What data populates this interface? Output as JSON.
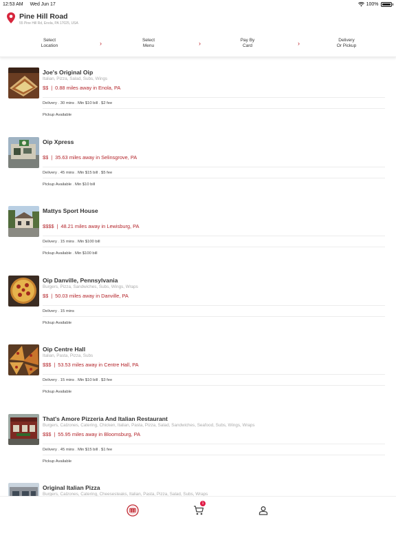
{
  "status": {
    "time": "12:53 AM",
    "date": "Wed Jun 17",
    "battery": "100%"
  },
  "header": {
    "title": "Pine Hill Road",
    "subtitle": "55 Pine Hill Rd, Enola, PA 17025, USA"
  },
  "steps": [
    {
      "label": "Select\nLocation"
    },
    {
      "label": "Select\nMenu"
    },
    {
      "label": "Pay By\nCard"
    },
    {
      "label": "Delivery\nOr Pickup"
    }
  ],
  "chevron": "›",
  "restaurants": [
    {
      "name": "Joe's Original Oip",
      "cuisine": "Italian, Pizza, Salad, Subs, Wings",
      "price": "$$",
      "separator": "|",
      "distance": "0.88 miles away in Enola, PA",
      "delivery": [
        "Delivery",
        "30 mins",
        "Min $10 bill",
        "$2 fee"
      ],
      "pickup": [
        "Pickup Available"
      ]
    },
    {
      "name": "Oip Xpress",
      "cuisine": "",
      "price": "$$",
      "separator": "|",
      "distance": "35.63 miles away in Selinsgrove, PA",
      "delivery": [
        "Delivery",
        "45 mins",
        "Min $15 bill",
        "$5 fee"
      ],
      "pickup": [
        "Pickup Available",
        "Min $10 bill"
      ]
    },
    {
      "name": "Mattys Sport House",
      "cuisine": "",
      "price": "$$$$",
      "separator": "|",
      "distance": "48.21 miles away in Lewisburg, PA",
      "delivery": [
        "Delivery",
        "15 mins",
        "Min $100 bill"
      ],
      "pickup": [
        "Pickup Available",
        "Min $100 bill"
      ]
    },
    {
      "name": "Oip Danville, Pennsylvania",
      "cuisine": "Burgers, Pizza, Sandwiches, Subs, Wings, Wraps",
      "price": "$$",
      "separator": "|",
      "distance": "50.03 miles away in Danville, PA",
      "delivery": [
        "Delivery",
        "15 mins"
      ],
      "pickup": [
        "Pickup Available"
      ]
    },
    {
      "name": "Oip Centre Hall",
      "cuisine": "Italian, Pasta, Pizza, Subs",
      "price": "$$$",
      "separator": "|",
      "distance": "53.53 miles away in Centre Hall, PA",
      "delivery": [
        "Delivery",
        "15 mins",
        "Min $10 bill",
        "$3 fee"
      ],
      "pickup": [
        "Pickup Available"
      ]
    },
    {
      "name": "That's Amore Pizzeria And Italian Restaurant",
      "cuisine": "Burgers, Calzones, Catering, Chicken, Italian, Pasta, Pizza, Salad, Sandwiches, Seafood, Subs, Wings, Wraps",
      "price": "$$$",
      "separator": "|",
      "distance": "55.95 miles away in Bloomsburg, PA",
      "delivery": [
        "Delivery",
        "45 mins",
        "Min $15 bill",
        "$1 fee"
      ],
      "pickup": [
        "Pickup Available"
      ]
    },
    {
      "name": "Original Italian Pizza",
      "cuisine": "Burgers, Calzones, Catering, Cheesesteaks, Italian, Pasta, Pizza, Salad, Subs, Wraps",
      "price": "",
      "separator": "",
      "distance": "",
      "delivery": [],
      "pickup": []
    }
  ],
  "tabbar": {
    "cart_count": "1",
    "icons": [
      "restaurant-logo-icon",
      "cart-icon",
      "profile-icon"
    ]
  },
  "colors": {
    "accent": "#b32329",
    "pin": "#d7263d",
    "badge": "#e01b46"
  }
}
